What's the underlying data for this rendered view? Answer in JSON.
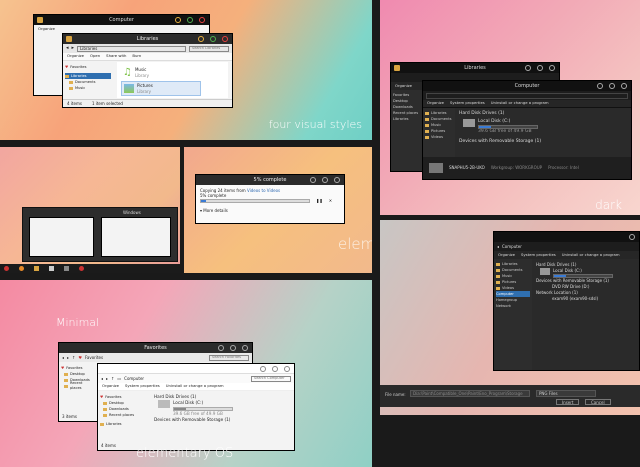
{
  "captions": {
    "four_styles": "four visual styles",
    "elementary": "elem",
    "dark": "dark",
    "minimal": "Minimal",
    "elementary_os": "elementary OS"
  },
  "win_libraries_light": {
    "back_title": "Computer",
    "title": "Libraries",
    "search": "Search Libraries",
    "cmd": [
      "Organize",
      "Open",
      "Share with",
      "Burn"
    ],
    "side": [
      "Favorites",
      "Libraries",
      "Documents",
      "Music"
    ],
    "side_back": [
      "Organize"
    ],
    "items": [
      {
        "name": "Music",
        "sub": "Library"
      },
      {
        "name": "Pictures",
        "sub": "Library"
      }
    ],
    "status_left": "4 items",
    "status_right": "1 item selected"
  },
  "win_progress": {
    "title": "5% complete",
    "line1": "Copying 24 items from",
    "line1_link": "Videos to Videos",
    "pct": "5% complete",
    "more": "More details",
    "pct_value": 5
  },
  "taskbar": {
    "thumb_title": "Windows"
  },
  "win_dark_libraries": {
    "title": "Libraries",
    "cmd": [
      "Organize"
    ],
    "side": [
      "Favorites",
      "Desktop",
      "Downloads",
      "Recent places",
      "Libraries"
    ]
  },
  "win_dark_computer": {
    "title": "Computer",
    "cmd": [
      "Organize",
      "System properties",
      "Uninstall or change a program"
    ],
    "side": [
      "Libraries",
      "Documents",
      "Music",
      "Pictures",
      "Videos"
    ],
    "hdd_header": "Hard Disk Drives (1)",
    "disk": "Local Disk (C:)",
    "disk_free": "39.6 GB free of 49.9 GB",
    "removable": "Devices with Removable Storage (1)",
    "computer_name": "SNAPHU5-2B-UKO",
    "workgroup": "Workgroup: WORKGROUP",
    "processor": "Processor: Intel"
  },
  "win_elem_dialog": {
    "title": "Computer",
    "cmd": [
      "Organize",
      "System properties",
      "Uninstall or change a program"
    ],
    "side": [
      "Libraries",
      "Documents",
      "Music",
      "Pictures",
      "Videos",
      "Computer",
      "Homegroup",
      "Network"
    ],
    "hdd_header": "Hard Disk Drives (1)",
    "disk": "Local Disk (C:)",
    "removable": "Devices with Removable Storage (1)",
    "dvd": "DVD RW Drive (D:)",
    "network": "Network Location (1)",
    "net_item": "exam90 (exam90-sdsl)",
    "computer_name": "SNAPHU5-2B-UKO",
    "filename_label": "File name:",
    "filename_value": "Dia:\\Paint\\Compatible_One\\Paint\\Eno_Program\\Storage",
    "filetype": "PNG Files",
    "open_btn": "Insert",
    "cancel_btn": "Cancel"
  },
  "win_favorites": {
    "title": "Favorites",
    "addr": "Favorites",
    "search": "Search Favorites",
    "side": [
      "Favorites",
      "Desktop",
      "Downloads",
      "Recent places"
    ],
    "status": "3 items",
    "libraries": "Libraries"
  },
  "win_min_computer": {
    "title": "Computer",
    "addr": "Computer",
    "search": "Search Computer",
    "cmd": [
      "Organize",
      "System properties",
      "Uninstall or change a program"
    ],
    "side": [
      "Favorites",
      "Desktop",
      "Downloads",
      "Recent places",
      "Libraries"
    ],
    "hdd_header": "Hard Disk Drives (1)",
    "disk": "Local Disk (C:)",
    "disk_free": "39.6 GB free of 49.9 GB",
    "removable": "Devices with Removable Storage (1)",
    "status": "4 items"
  },
  "colors": {
    "accent": "#3a7bd5",
    "close": "#e84040",
    "min": "#e8b040",
    "max": "#50b050"
  }
}
